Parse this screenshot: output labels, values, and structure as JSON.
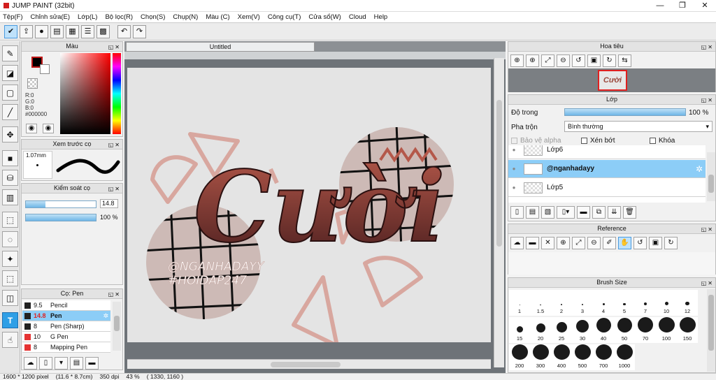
{
  "window": {
    "title": "JUMP PAINT (32bit)",
    "min": "—",
    "max": "❐",
    "close": "✕"
  },
  "menu": [
    "Tệp(F)",
    "Chỉnh sửa(E)",
    "Lớp(L)",
    "Bộ lọc(R)",
    "Chọn(S)",
    "Chụp(N)",
    "Màu (C)",
    "Xem(V)",
    "Công cụ(T)",
    "Cửa sổ(W)",
    "Cloud",
    "Help"
  ],
  "color_panel": {
    "title": "Màu",
    "r": "R:0",
    "g": "G:0",
    "b": "B:0",
    "hex": "#000000"
  },
  "brush_preview": {
    "title": "Xem trước cọ",
    "size": "1.07mm"
  },
  "brush_control": {
    "title": "Kiểm soát cọ",
    "size_value": "14.8",
    "opacity_value": "100 %",
    "size_ratio": 0.28,
    "opacity_ratio": 1.0
  },
  "brush_panel": {
    "title": "Cọ: Pen",
    "items": [
      {
        "size": "9.5",
        "name": "Pencil",
        "color": "#222222"
      },
      {
        "size": "14.8",
        "name": "Pen",
        "color": "#222222"
      },
      {
        "size": "8",
        "name": "Pen (Sharp)",
        "color": "#222222"
      },
      {
        "size": "10",
        "name": "G Pen",
        "color": "#e53333"
      },
      {
        "size": "8",
        "name": "Mapping Pen",
        "color": "#e53333"
      }
    ]
  },
  "document": {
    "tab": "Untitled",
    "watermark1": "@NGANHADAYY",
    "watermark2": "#HOIDAP247",
    "art_text": "Cười",
    "accent": "#b4584a"
  },
  "navigator": {
    "title": "Hoa tiêu",
    "thumb_text": "Cười"
  },
  "layer_panel": {
    "title": "Lớp",
    "opacity_label": "Độ trong",
    "opacity_value": "100 %",
    "opacity_ratio": 1.0,
    "blend_label": "Pha trộn",
    "blend_value": "Bình thường",
    "protect_alpha": "Bảo vệ alpha",
    "clip": "Xén bớt",
    "lock": "Khóa",
    "layers": [
      "Lớp6",
      "@nganhadayy",
      "Lớp5"
    ]
  },
  "reference": {
    "title": "Reference"
  },
  "brush_size": {
    "title": "Brush Size",
    "sizes": [
      "1",
      "1.5",
      "2",
      "3",
      "4",
      "5",
      "7",
      "10",
      "12",
      "15",
      "20",
      "25",
      "30",
      "40",
      "50",
      "70",
      "100",
      "150",
      "200",
      "300",
      "400",
      "500",
      "700",
      "1000"
    ]
  },
  "status": {
    "dimensions": "1600 * 1200 pixel",
    "physical": "(11.6 * 8.7cm)",
    "dpi": "350 dpi",
    "zoom": "43 %",
    "cursor": "( 1330, 1160 )"
  }
}
